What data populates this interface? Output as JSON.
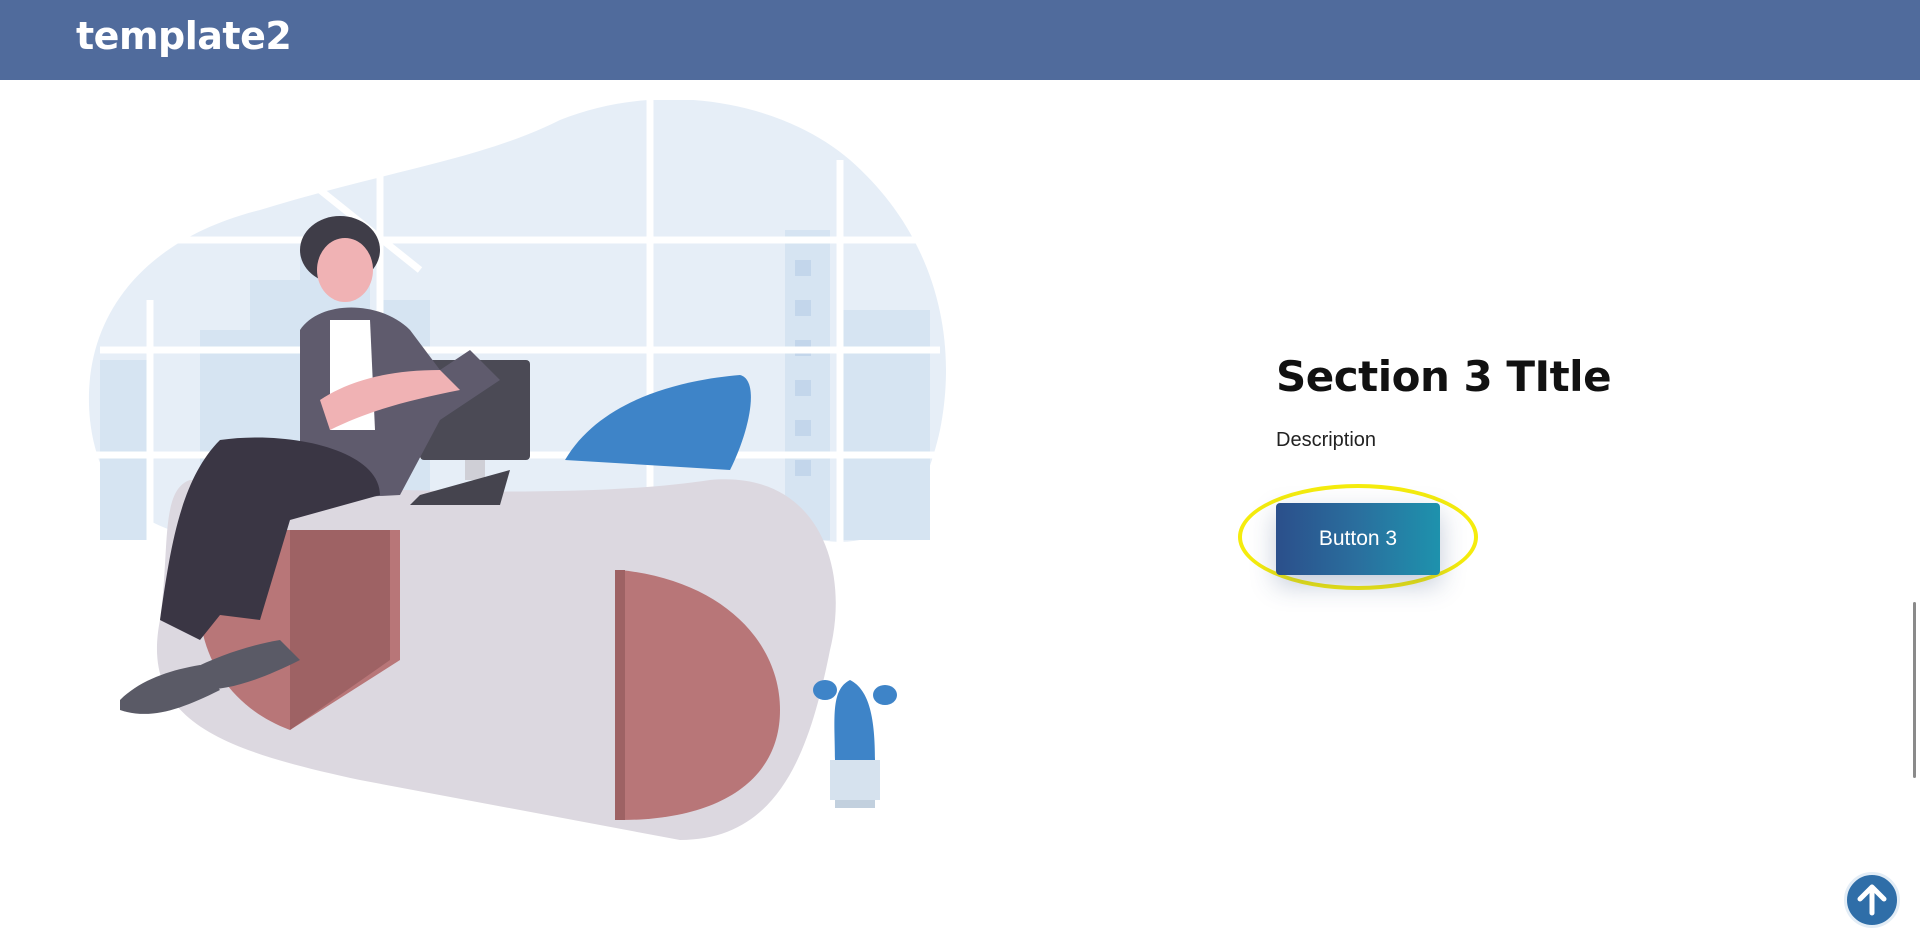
{
  "header": {
    "brand": "template2"
  },
  "section": {
    "title": "Section 3 TItle",
    "description": "Description",
    "button_label": "Button 3"
  },
  "colors": {
    "header_bg": "#506b9c",
    "button_gradient_start": "#2b4f8b",
    "button_gradient_end": "#1e92ad",
    "highlight_ring": "#f5ec0d",
    "scroll_top_bg": "#2f6ea8"
  },
  "icons": {
    "scroll_top": "arrow-up-icon"
  }
}
